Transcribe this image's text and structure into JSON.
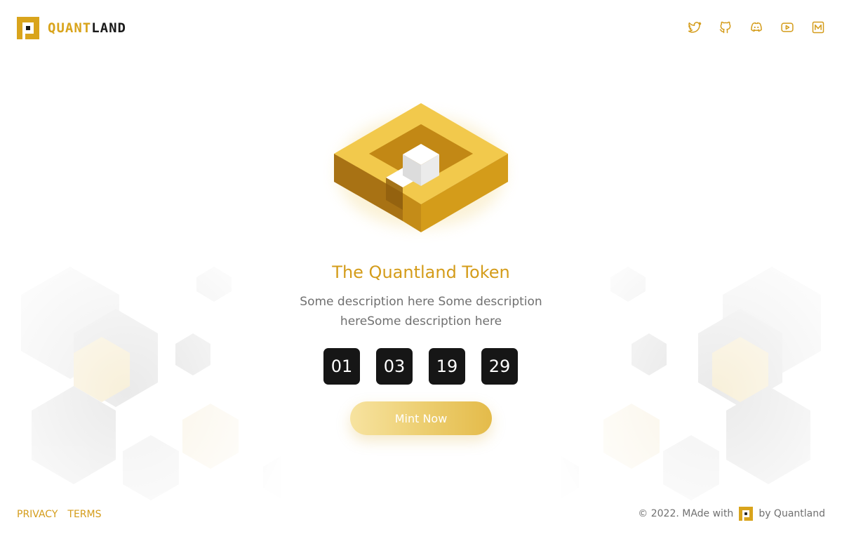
{
  "header": {
    "brand_part1": "QUANT",
    "brand_part2": "LAND",
    "socials": [
      "twitter-icon",
      "github-icon",
      "discord-icon",
      "youtube-icon",
      "medium-icon"
    ]
  },
  "hero": {
    "title": "The Quantland Token",
    "description": "Some description here Some description hereSome description here",
    "countdown": [
      "01",
      "03",
      "19",
      "29"
    ],
    "cta_label": "Mint Now"
  },
  "footer": {
    "links": [
      "PRIVACY",
      "TERMS"
    ],
    "credit_prefix": "© 2022. MAde with",
    "credit_suffix": "by Quantland"
  },
  "colors": {
    "accent": "#d49c1a",
    "dark": "#161616",
    "text_muted": "#707070"
  }
}
